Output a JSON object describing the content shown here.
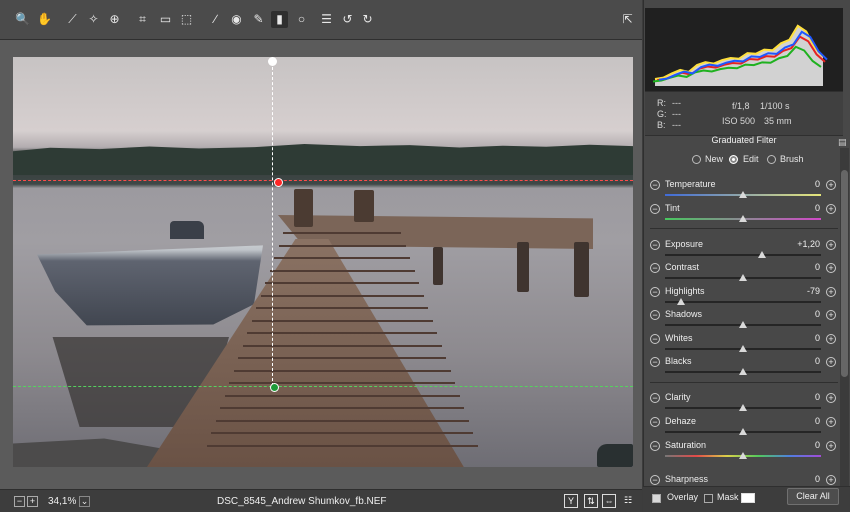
{
  "toolbar": {
    "tools": [
      {
        "name": "zoom-tool-icon",
        "glyph": "🔍"
      },
      {
        "name": "hand-tool-icon",
        "glyph": "✋"
      },
      {
        "name": "white-balance-icon",
        "glyph": "⟋"
      },
      {
        "name": "color-sampler-icon",
        "glyph": "✧"
      },
      {
        "name": "targeted-adjustment-icon",
        "glyph": "⊕"
      },
      {
        "name": "crop-tool-icon",
        "glyph": "⌗"
      },
      {
        "name": "straighten-icon",
        "glyph": "▭"
      },
      {
        "name": "transform-icon",
        "glyph": "⬚"
      },
      {
        "name": "spot-removal-icon",
        "glyph": "∕"
      },
      {
        "name": "red-eye-icon",
        "glyph": "◉"
      },
      {
        "name": "adjustment-brush-icon",
        "glyph": "✎"
      },
      {
        "name": "graduated-filter-icon",
        "glyph": "▮"
      },
      {
        "name": "radial-filter-icon",
        "glyph": "○"
      },
      {
        "name": "preferences-icon",
        "glyph": "☰"
      },
      {
        "name": "rotate-left-icon",
        "glyph": "↺"
      },
      {
        "name": "rotate-right-icon",
        "glyph": "↻"
      }
    ],
    "right_icon": "⇱"
  },
  "status": {
    "zoom": "34,1%",
    "filename": "DSC_8545_Andrew Shumkov_fb.NEF",
    "zoom_out": "−",
    "zoom_in": "+",
    "menu": "⌄",
    "preview_label": "Y"
  },
  "histogram": {
    "values": [
      0.1,
      0.12,
      0.18,
      0.23,
      0.2,
      0.3,
      0.34,
      0.32,
      0.37,
      0.4,
      0.39,
      0.47,
      0.46,
      0.52,
      0.51,
      0.61,
      0.66,
      0.86,
      0.78,
      0.55,
      0.42
    ]
  },
  "info": {
    "r": "R:",
    "g": "G:",
    "b": "B:",
    "rv": "---",
    "gv": "---",
    "bv": "---",
    "aperture": "f/1,8",
    "shutter": "1/100 s",
    "iso": "ISO 500",
    "focal": "35 mm"
  },
  "panel": {
    "title": "Graduated Filter",
    "modes": [
      "New",
      "Edit",
      "Brush"
    ],
    "selected_mode": "Edit"
  },
  "sliders": [
    {
      "label": "Temperature",
      "value": "0",
      "pos": 0.5
    },
    {
      "label": "Tint",
      "value": "0",
      "pos": 0.5
    },
    {
      "label": "Exposure",
      "value": "+1,20",
      "pos": 0.62
    },
    {
      "label": "Contrast",
      "value": "0",
      "pos": 0.5
    },
    {
      "label": "Highlights",
      "value": "-79",
      "pos": 0.1
    },
    {
      "label": "Shadows",
      "value": "0",
      "pos": 0.5
    },
    {
      "label": "Whites",
      "value": "0",
      "pos": 0.5
    },
    {
      "label": "Blacks",
      "value": "0",
      "pos": 0.5
    },
    {
      "label": "Clarity",
      "value": "0",
      "pos": 0.5
    },
    {
      "label": "Dehaze",
      "value": "0",
      "pos": 0.5
    },
    {
      "label": "Saturation",
      "value": "0",
      "pos": 0.5
    },
    {
      "label": "Sharpness",
      "value": "0",
      "pos": 0.5
    }
  ],
  "bottom": {
    "overlay": "Overlay",
    "mask": "Mask",
    "clear_all": "Clear All"
  }
}
